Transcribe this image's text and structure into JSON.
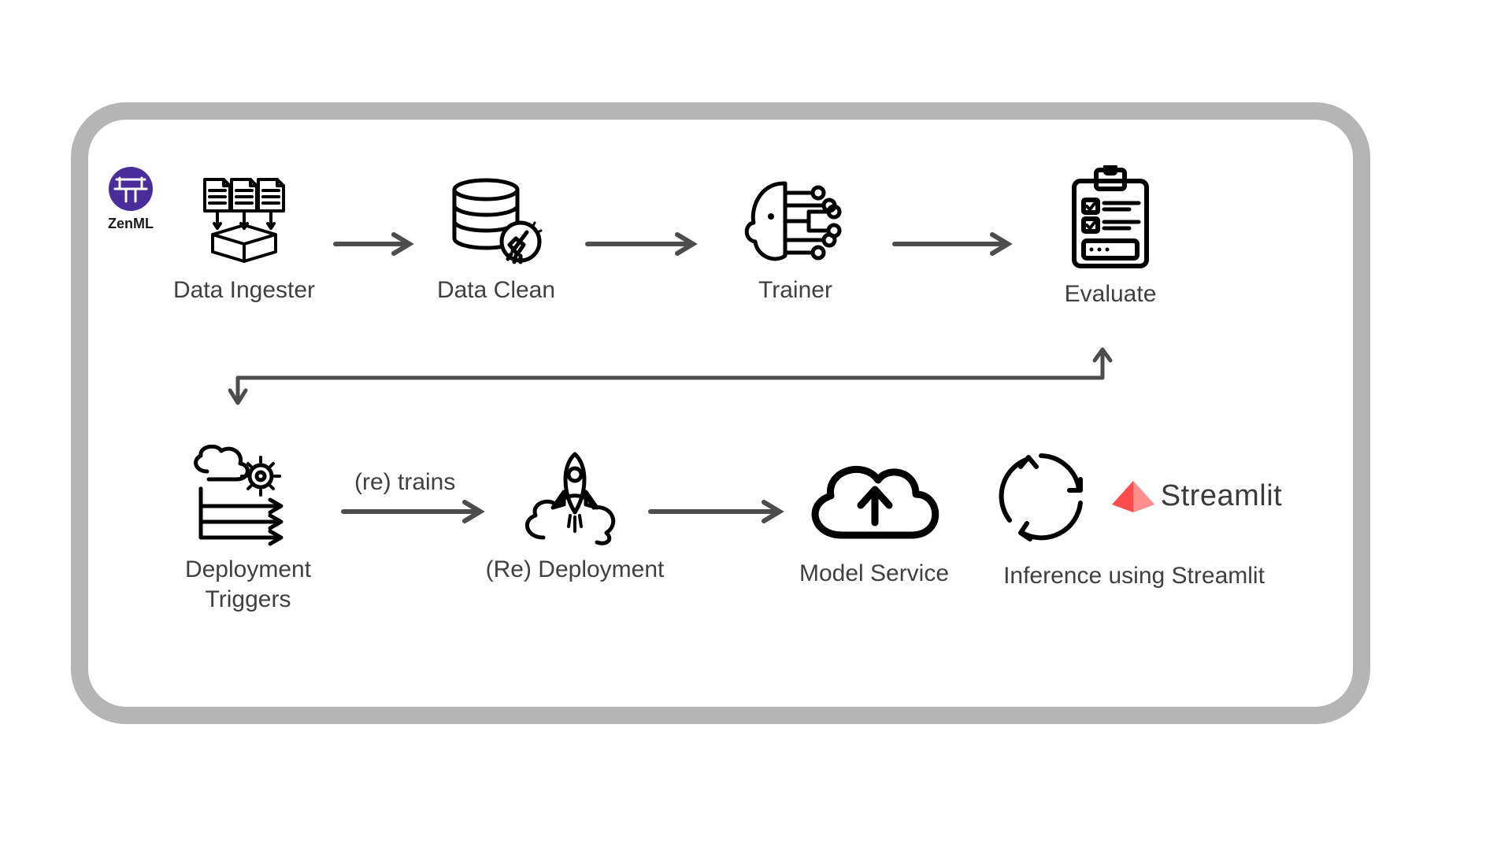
{
  "brand": {
    "zenml": "ZenML",
    "streamlit": "Streamlit"
  },
  "nodes": {
    "ingest": "Data Ingester",
    "clean": "Data Clean",
    "trainer": "Trainer",
    "evaluate": "Evaluate",
    "triggers": "Deployment\nTriggers",
    "redeploy": "(Re) Deployment",
    "service": "Model Service",
    "inference": "Inference using Streamlit"
  },
  "arrow_labels": {
    "retrains": "(re) trains"
  }
}
